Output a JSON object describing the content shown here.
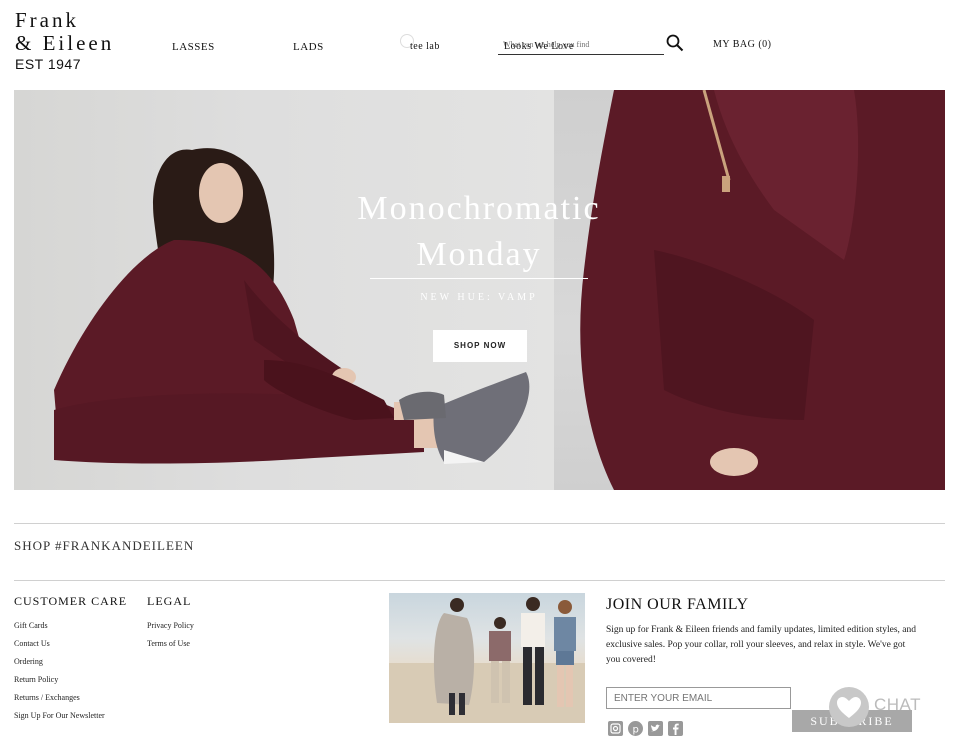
{
  "brand": {
    "line1": "Frank",
    "line2": "& Eileen",
    "line3": "EST 1947"
  },
  "nav": {
    "items": [
      {
        "label": "LASSES"
      },
      {
        "label": "LADS"
      },
      {
        "label": "tee lab"
      },
      {
        "label": "Looks We Love"
      }
    ],
    "search_placeholder": "What can we help you find",
    "bag_label": "MY BAG (0)"
  },
  "hero": {
    "title_line1": "Monochromatic",
    "title_line2": "Monday",
    "subtitle": "NEW HUE: VAMP",
    "cta_label": "SHOP NOW",
    "colors": {
      "garment": "#5b1a26",
      "overlay_text": "#ffffff"
    }
  },
  "hashtag": "SHOP #FRANKANDEILEEN",
  "footer": {
    "customer_care": {
      "heading": "CUSTOMER CARE",
      "links": [
        "Gift Cards",
        "Contact Us",
        "Ordering",
        "Return Policy",
        "Returns / Exchanges",
        "Sign Up For Our Newsletter"
      ]
    },
    "legal": {
      "heading": "LEGAL",
      "links": [
        "Privacy Policy",
        "Terms of Use"
      ]
    },
    "newsletter": {
      "heading": "JOIN OUR FAMILY",
      "body": "Sign up for Frank & Eileen friends and family updates, limited edition styles, and exclusive sales. Pop your collar, roll your sleeves, and relax in style. We've got you covered!",
      "email_placeholder": "ENTER YOUR EMAIL",
      "subscribe_label": "SUBSCRIBE"
    },
    "social_icons": [
      "instagram-icon",
      "pinterest-icon",
      "twitter-icon",
      "facebook-icon"
    ],
    "chat_label": "CHAT"
  }
}
